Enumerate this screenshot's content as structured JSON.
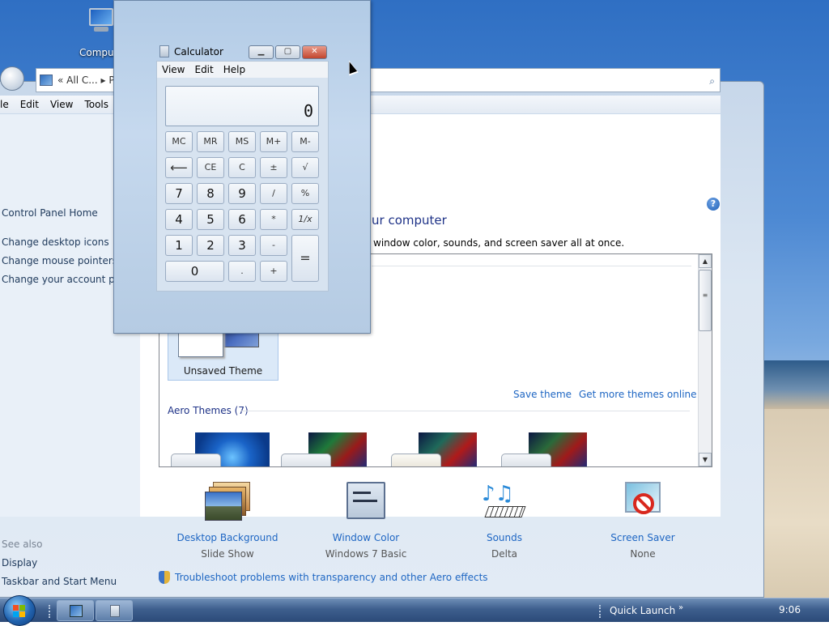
{
  "desktop": {
    "icons": [
      {
        "label": "Computer",
        "icon": "computer-icon"
      }
    ]
  },
  "personalization": {
    "window_buttons": [
      "minimize",
      "maximize",
      "close"
    ],
    "address_text": "« All C... ▸ P",
    "menu": [
      "le",
      "Edit",
      "View",
      "Tools"
    ],
    "left_links": [
      "Control Panel Home",
      "Change desktop icons",
      "Change mouse pointers",
      "Change your account pict"
    ],
    "see_also_title": "See also",
    "see_also_links": [
      "Display",
      "Taskbar and Start Menu"
    ],
    "heading": "ur computer",
    "description": "window color, sounds, and screen saver all at once.",
    "unsaved_theme_label": "Unsaved Theme",
    "save_theme": "Save theme",
    "get_more": "Get more themes online",
    "aero_themes": "Aero Themes (7)",
    "bottom_items": [
      {
        "label": "Desktop Background",
        "sub": "Slide Show",
        "icon": "desktop-background-icon"
      },
      {
        "label": "Window Color",
        "sub": "Windows 7 Basic",
        "icon": "window-color-icon"
      },
      {
        "label": "Sounds",
        "sub": "Delta",
        "icon": "sounds-icon"
      },
      {
        "label": "Screen Saver",
        "sub": "None",
        "icon": "screen-saver-icon"
      }
    ],
    "troubleshoot": "Troubleshoot problems with transparency and other Aero effects"
  },
  "calculator": {
    "title": "Calculator",
    "menu": [
      "View",
      "Edit",
      "Help"
    ],
    "display": "0",
    "keys": {
      "mc": "MC",
      "mr": "MR",
      "ms": "MS",
      "mplus": "M+",
      "mminus": "M-",
      "back": "⟵",
      "ce": "CE",
      "c": "C",
      "pm": "±",
      "sqrt": "√",
      "seven": "7",
      "eight": "8",
      "nine": "9",
      "div": "/",
      "pct": "%",
      "four": "4",
      "five": "5",
      "six": "6",
      "mul": "*",
      "inv": "1/x",
      "one": "1",
      "two": "2",
      "three": "3",
      "minus": "-",
      "eq": "=",
      "zero": "0",
      "dot": ".",
      "plus": "+"
    }
  },
  "taskbar": {
    "quick_launch": "Quick Launch",
    "clock": "9:06"
  },
  "colors": {
    "link": "#1e66c3",
    "heading": "#1e3287",
    "taskbar": "#3e5f8e"
  }
}
